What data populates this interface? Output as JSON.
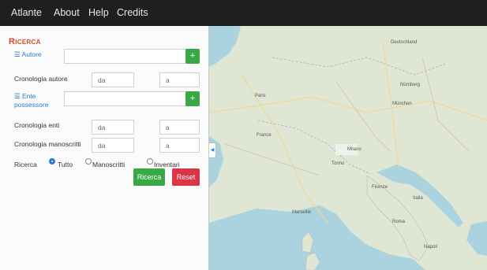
{
  "navbar": {
    "items": [
      "Atlante",
      "About",
      "Help",
      "Credits"
    ]
  },
  "search_panel": {
    "title": "Ricerca",
    "autore_label": "Autore",
    "add_icon": "+",
    "cronologia_autore_label": "Cronologia autore",
    "from_placeholder": "da",
    "to_placeholder": "a",
    "ente_label_line1": "Ente",
    "ente_label_line2": "possessore",
    "cronologia_enti_label": "Cronologia enti",
    "cronologia_manoscritti_label": "Cronologia manoscritti",
    "ricerca_label": "Ricerca",
    "radio_options": [
      "Tutto",
      "Manoscritti",
      "Inventari"
    ],
    "selected_option": "Tutto",
    "search_button": "Ricerca",
    "reset_button": "Reset"
  },
  "colors": {
    "navbar": "#1f1f1f",
    "title": "#d9462b",
    "link": "#2b7ad3",
    "add_button": "#3aa847",
    "search_button": "#3aa847",
    "reset_button": "#dc3545",
    "sea": "#aad3df",
    "land": "#dfe7d4"
  },
  "map": {
    "labels": [
      "Deutschland",
      "Nürnberg",
      "Paris",
      "München",
      "France",
      "Milano",
      "Torino",
      "Marseille",
      "Roma",
      "Italia",
      "Napoli",
      "Firenze"
    ]
  }
}
